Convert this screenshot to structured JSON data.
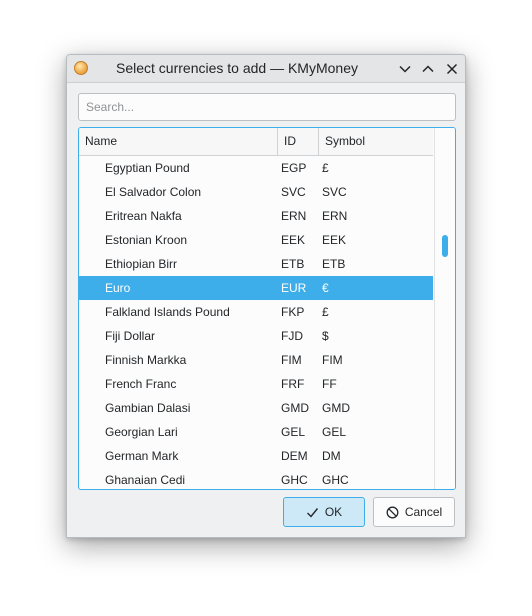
{
  "window": {
    "title": "Select currencies to add — KMyMoney"
  },
  "search": {
    "placeholder": "Search...",
    "value": ""
  },
  "table": {
    "columns": [
      "Name",
      "ID",
      "Symbol"
    ],
    "rows": [
      {
        "name": "Egyptian Pound",
        "id": "EGP",
        "symbol": "£"
      },
      {
        "name": "El Salvador Colon",
        "id": "SVC",
        "symbol": "SVC"
      },
      {
        "name": "Eritrean Nakfa",
        "id": "ERN",
        "symbol": "ERN"
      },
      {
        "name": "Estonian Kroon",
        "id": "EEK",
        "symbol": "EEK"
      },
      {
        "name": "Ethiopian Birr",
        "id": "ETB",
        "symbol": "ETB"
      },
      {
        "name": "Euro",
        "id": "EUR",
        "symbol": "€",
        "selected": true
      },
      {
        "name": "Falkland Islands Pound",
        "id": "FKP",
        "symbol": "£"
      },
      {
        "name": "Fiji Dollar",
        "id": "FJD",
        "symbol": "$"
      },
      {
        "name": "Finnish Markka",
        "id": "FIM",
        "symbol": "FIM"
      },
      {
        "name": "French Franc",
        "id": "FRF",
        "symbol": "FF"
      },
      {
        "name": "Gambian Dalasi",
        "id": "GMD",
        "symbol": "GMD"
      },
      {
        "name": "Georgian Lari",
        "id": "GEL",
        "symbol": "GEL"
      },
      {
        "name": "German Mark",
        "id": "DEM",
        "symbol": "DM"
      },
      {
        "name": "Ghanaian Cedi",
        "id": "GHC",
        "symbol": "GHC"
      }
    ]
  },
  "buttons": {
    "ok_label": "OK",
    "cancel_label": "Cancel"
  },
  "icons": {
    "app": "kmymoney-app-icon",
    "minimize": "chevron-down-icon",
    "maximize": "chevron-up-icon",
    "close": "close-icon",
    "ok": "checkmark-icon",
    "cancel": "cancel-circle-icon"
  },
  "colors": {
    "accent": "#3daee9",
    "selected_text": "#ffffff",
    "ok_background": "#cde8f7"
  }
}
